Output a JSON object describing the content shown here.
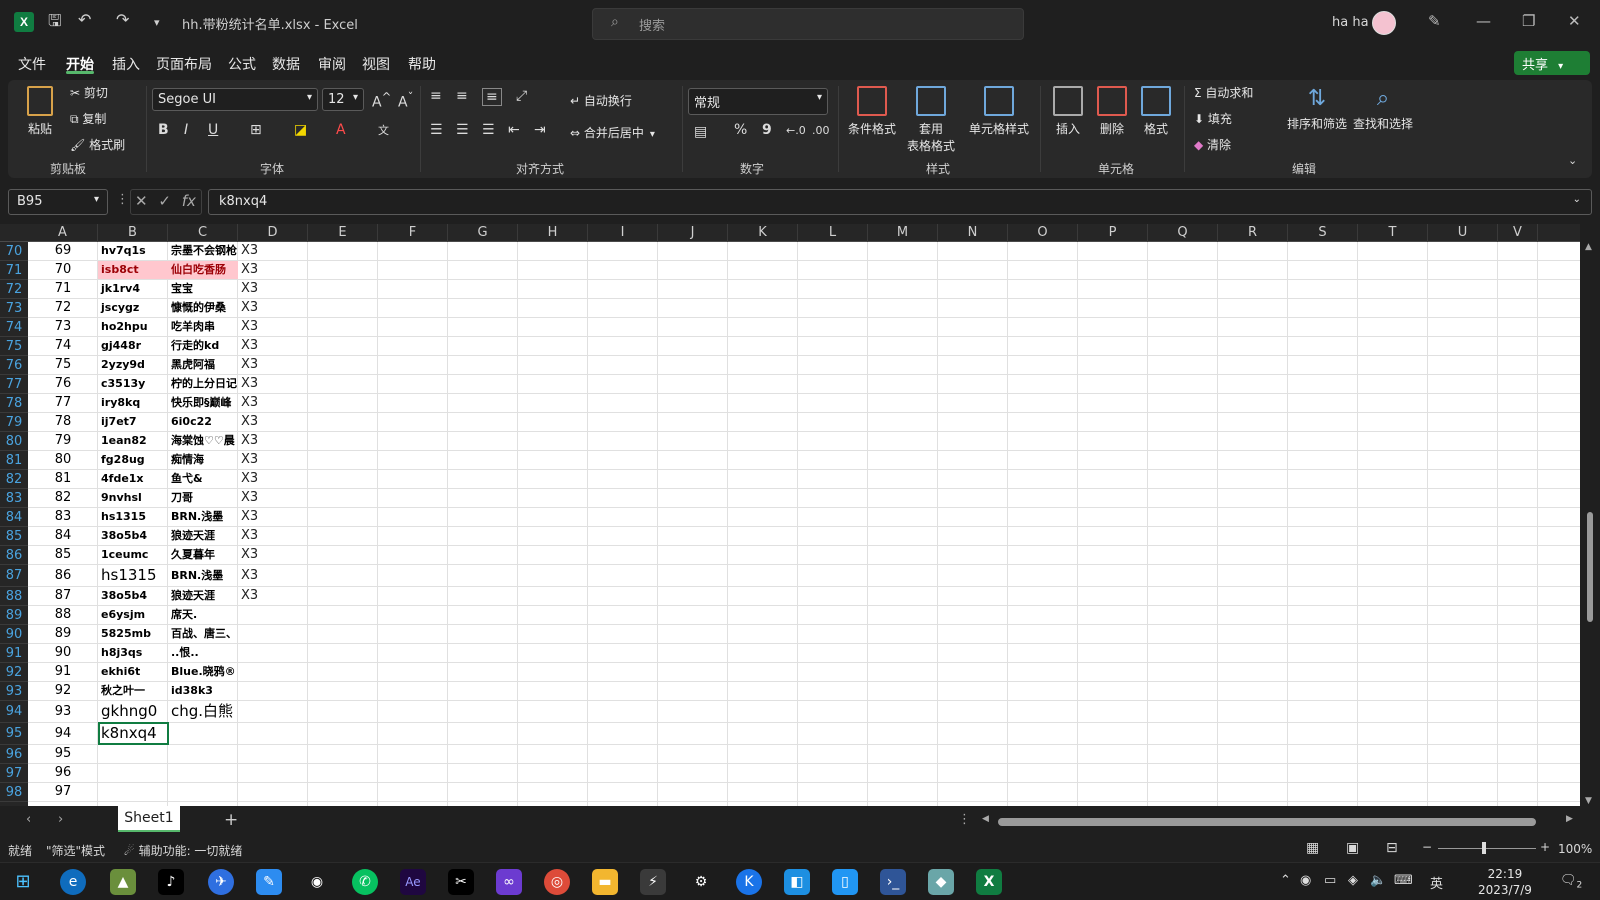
{
  "titlebar": {
    "document_title": "hh.带粉统计名单.xlsx  -  Excel",
    "search_placeholder": "搜索",
    "user_name": "ha ha"
  },
  "menu": [
    "文件",
    "开始",
    "插入",
    "页面布局",
    "公式",
    "数据",
    "审阅",
    "视图",
    "帮助"
  ],
  "active_menu": "开始",
  "share_label": "共享",
  "ribbon": {
    "clipboard": {
      "paste": "粘贴",
      "cut": "剪切",
      "copy": "复制",
      "format_painter": "格式刷",
      "label": "剪贴板"
    },
    "font": {
      "name": "Segoe UI",
      "size": "12",
      "label": "字体",
      "bold": "B",
      "italic": "I",
      "underline": "U"
    },
    "alignment": {
      "wrap": "自动换行",
      "merge": "合并后居中",
      "label": "对齐方式"
    },
    "number": {
      "format": "常规",
      "percent": "%",
      "comma": "9",
      "label": "数字"
    },
    "styles": {
      "conditional": "条件格式",
      "table_format_1": "套用",
      "table_format_2": "表格格式",
      "cell_styles": "单元格样式",
      "label": "样式"
    },
    "cells": {
      "insert": "插入",
      "delete": "删除",
      "format": "格式",
      "label": "单元格"
    },
    "editing": {
      "autosum": "自动求和",
      "fill": "填充",
      "clear": "清除",
      "sort_filter": "排序和筛选",
      "find_select": "查找和选择",
      "label": "编辑"
    }
  },
  "formula_bar": {
    "name_box": "B95",
    "fx": "fx",
    "value": "k8nxq4"
  },
  "columns": [
    "A",
    "B",
    "C",
    "D",
    "E",
    "F",
    "G",
    "H",
    "I",
    "J",
    "K",
    "L",
    "M",
    "N",
    "O",
    "P",
    "Q",
    "R",
    "S",
    "T",
    "U",
    "V"
  ],
  "rows": [
    {
      "n": "70",
      "a": "69",
      "b": "hv7q1s",
      "c": "宗墨不会钢枪",
      "d": "X3"
    },
    {
      "n": "71",
      "a": "70",
      "b": "isb8ct",
      "c": "仙白吃香肠",
      "d": "X3",
      "hl": true
    },
    {
      "n": "72",
      "a": "71",
      "b": "jk1rv4",
      "c": "宝宝",
      "d": "X3"
    },
    {
      "n": "73",
      "a": "72",
      "b": "jscygz",
      "c": "慷慨的伊桑",
      "d": "X3"
    },
    {
      "n": "74",
      "a": "73",
      "b": "ho2hpu",
      "c": "吃羊肉串",
      "d": "X3"
    },
    {
      "n": "75",
      "a": "74",
      "b": "gj448r",
      "c": "行走的kd",
      "d": "X3"
    },
    {
      "n": "76",
      "a": "75",
      "b": "2yzy9d",
      "c": "黑虎阿福",
      "d": "X3"
    },
    {
      "n": "77",
      "a": "76",
      "b": "c3513y",
      "c": "柠的上分日记",
      "d": "X3"
    },
    {
      "n": "78",
      "a": "77",
      "b": "iry8kq",
      "c": "快乐即§巅峰",
      "d": "X3"
    },
    {
      "n": "79",
      "a": "78",
      "b": "ij7et7",
      "c": "6i0c22",
      "d": "X3"
    },
    {
      "n": "80",
      "a": "79",
      "b": "1ean82",
      "c": "海棠蚀♡♡晨",
      "d": "X3"
    },
    {
      "n": "81",
      "a": "80",
      "b": "fg28ug",
      "c": "痴情海",
      "d": "X3"
    },
    {
      "n": "82",
      "a": "81",
      "b": "4fde1x",
      "c": "鱼弋&",
      "d": "X3"
    },
    {
      "n": "83",
      "a": "82",
      "b": "9nvhsl",
      "c": "刀哥",
      "d": "X3"
    },
    {
      "n": "84",
      "a": "83",
      "b": "hs1315",
      "c": "BRN.浅墨",
      "d": "X3"
    },
    {
      "n": "85",
      "a": "84",
      "b": "38o5b4",
      "c": "狼迹天涯",
      "d": "X3"
    },
    {
      "n": "86",
      "a": "85",
      "b": "1ceumc",
      "c": "久夏暮年",
      "d": "X3"
    },
    {
      "n": "87",
      "a": "86",
      "b": "hs1315",
      "c": "BRN.浅墨",
      "d": "X3",
      "big_b": true
    },
    {
      "n": "88",
      "a": "87",
      "b": "38o5b4",
      "c": "狼迹天涯",
      "d": "X3"
    },
    {
      "n": "89",
      "a": "88",
      "b": "e6ysjm",
      "c": "席天.",
      "d": ""
    },
    {
      "n": "90",
      "a": "89",
      "b": "5825mb",
      "c": "百战、唐三、",
      "d": ""
    },
    {
      "n": "91",
      "a": "90",
      "b": "h8j3qs",
      "c": "..恨..",
      "d": ""
    },
    {
      "n": "92",
      "a": "91",
      "b": "ekhi6t",
      "c": "Blue.晓鸦®",
      "d": ""
    },
    {
      "n": "93",
      "a": "92",
      "b": "秋之叶一",
      "c": "id38k3",
      "d": ""
    },
    {
      "n": "94",
      "a": "93",
      "b": "gkhng0",
      "c": "chg.白熊",
      "d": "",
      "big_b": true,
      "big_c": true
    },
    {
      "n": "95",
      "a": "94",
      "b": "k8nxq4",
      "c": "",
      "d": "",
      "big_b": true
    },
    {
      "n": "96",
      "a": "95",
      "b": "",
      "c": "",
      "d": ""
    },
    {
      "n": "97",
      "a": "96",
      "b": "",
      "c": "",
      "d": ""
    },
    {
      "n": "98",
      "a": "97",
      "b": "",
      "c": "",
      "d": ""
    }
  ],
  "sheet_tab": "Sheet1",
  "status": {
    "ready": "就绪",
    "filter_mode": "\"筛选\"模式",
    "accessibility": "辅助功能: 一切就绪",
    "zoom": "100%"
  },
  "taskbar": {
    "time": "22:19",
    "date": "2023/7/9",
    "ime": "英",
    "notifications": "2"
  },
  "colors": {
    "accent": "#107c41",
    "highlight_fill": "#ffc7ce",
    "highlight_text": "#9c0006",
    "row_number": "#4aa3df"
  }
}
